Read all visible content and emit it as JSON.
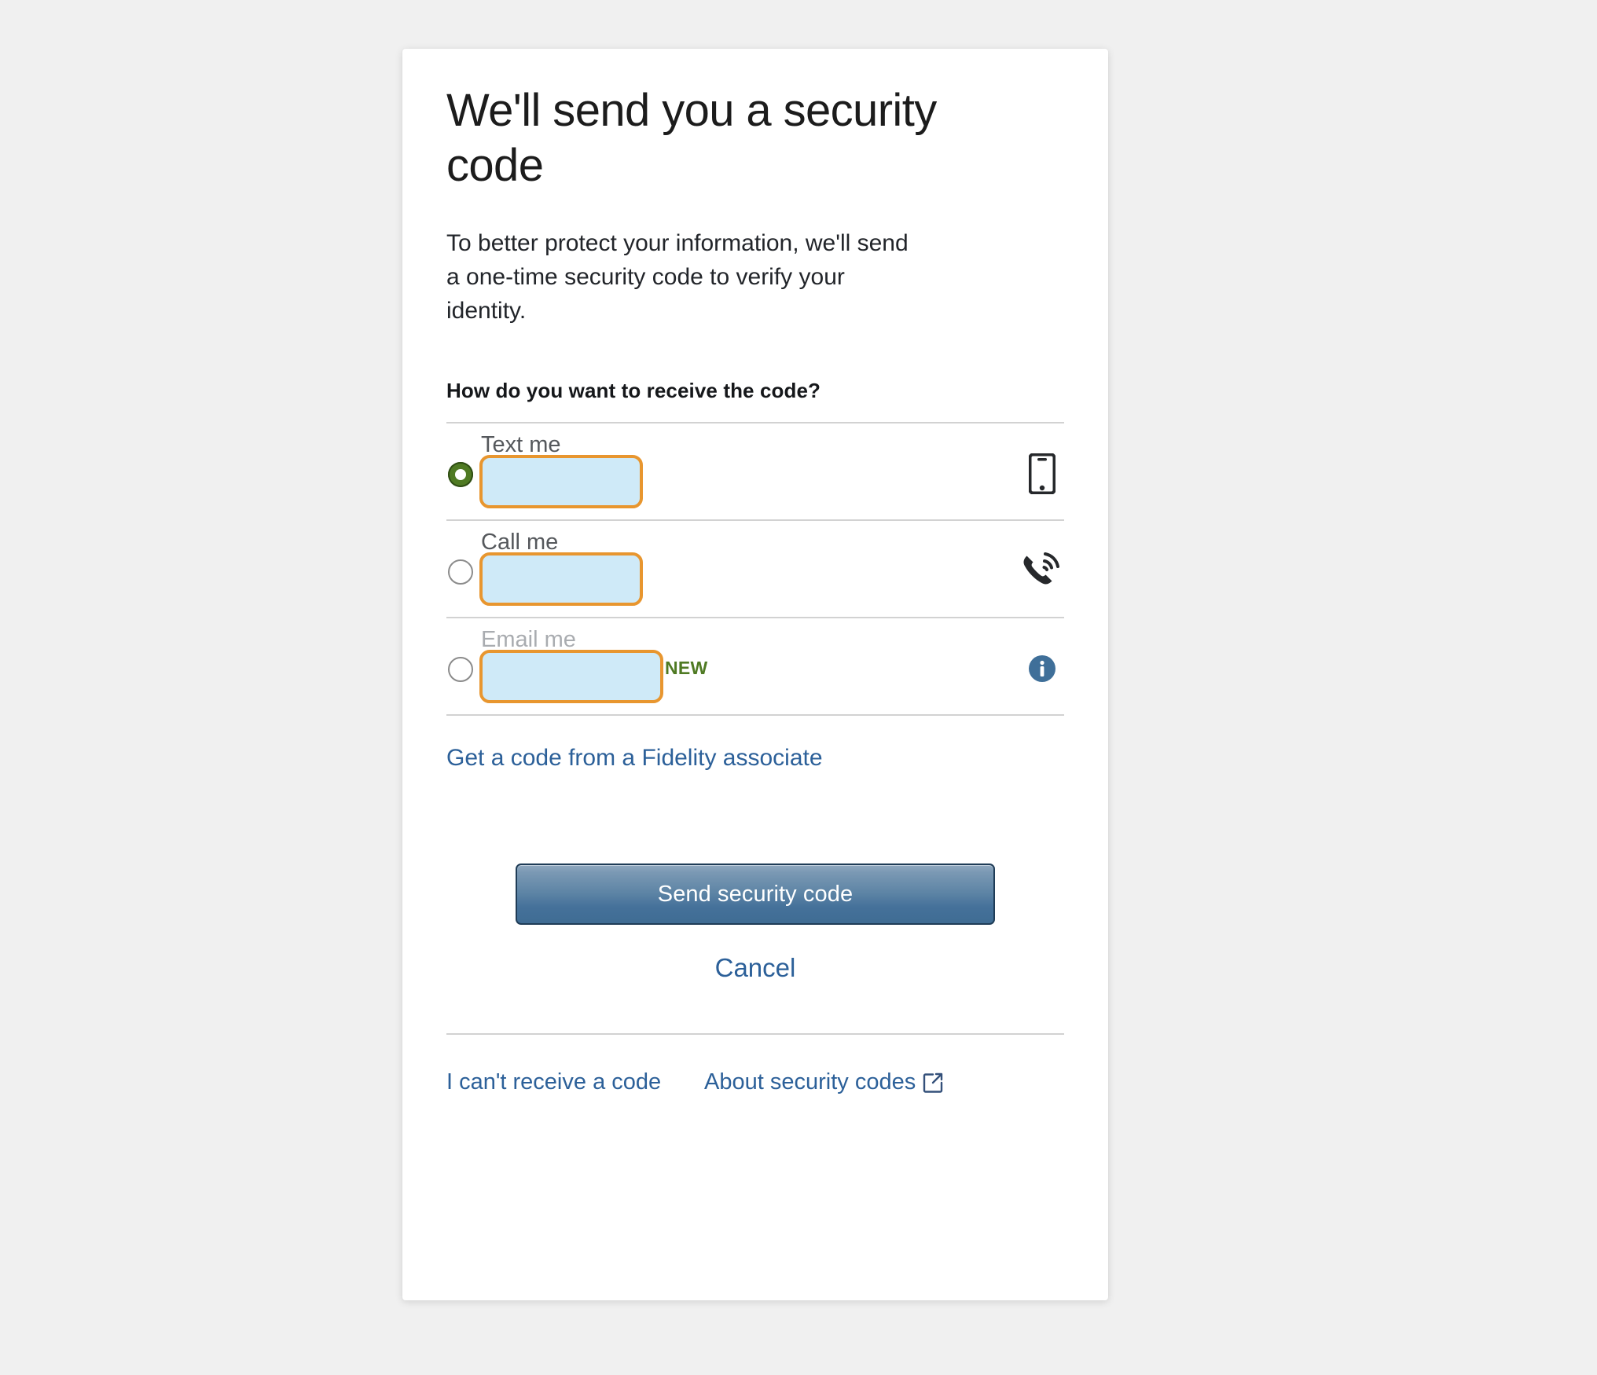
{
  "page": {
    "background_color": "#f0f0f0",
    "card_background": "#ffffff"
  },
  "heading": {
    "title": "We'll send you a security code",
    "description": "To better protect your information, we'll send a one-time security code to verify your identity."
  },
  "delivery": {
    "question": "How do you want to receive the code?",
    "selected_option": "text-me",
    "options": [
      {
        "id": "text-me",
        "label": "Text me",
        "selected": true,
        "disabled": false,
        "masked_value": "",
        "icon": "mobile-phone-icon",
        "badge": ""
      },
      {
        "id": "call-me",
        "label": "Call me",
        "selected": false,
        "disabled": false,
        "masked_value": "",
        "icon": "phone-ringing-icon",
        "badge": ""
      },
      {
        "id": "email-me",
        "label": "Email me",
        "selected": false,
        "disabled": true,
        "masked_value": "",
        "icon": "info-circle-icon",
        "badge": "NEW"
      }
    ],
    "associate_link": "Get a code from a Fidelity associate"
  },
  "actions": {
    "primary_label": "Send security code",
    "cancel_label": "Cancel"
  },
  "footer": {
    "cannot_receive_label": "I can't receive a code",
    "about_label": "About security codes",
    "about_icon": "external-link-icon"
  },
  "colors": {
    "link": "#2c6099",
    "accent_green": "#4f7a23",
    "mask_border": "#e8962f",
    "mask_fill": "#cfeaf8",
    "button_blue": "#45719a",
    "info_blue": "#3f6f99",
    "divider": "#d2d2d2"
  }
}
